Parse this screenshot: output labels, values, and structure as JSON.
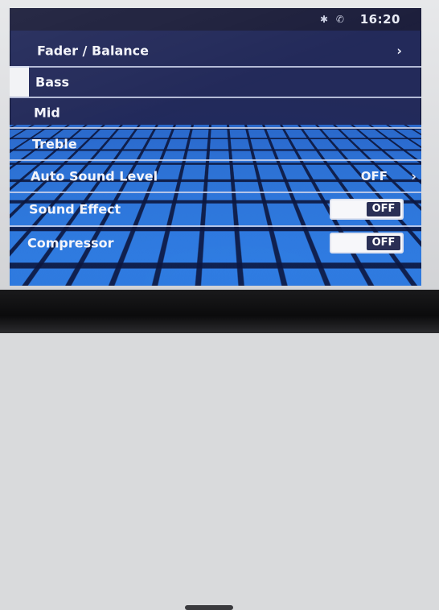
{
  "status_bar": {
    "icons": [
      "bluetooth-icon",
      "phone-muted-icon"
    ],
    "time": "16:20"
  },
  "settings": [
    {
      "label": "Fader / Balance",
      "control": "chevron"
    },
    {
      "label": "Bass",
      "control": "none"
    },
    {
      "label": "Mid",
      "control": "none"
    },
    {
      "label": "Treble",
      "control": "none"
    },
    {
      "label": "Auto Sound Level",
      "control": "value-chevron",
      "value": "OFF"
    },
    {
      "label": "Sound Effect",
      "control": "toggle",
      "value": "OFF"
    },
    {
      "label": "Compressor",
      "control": "toggle",
      "value": "OFF"
    }
  ],
  "colors": {
    "screen_bg": "#1f2a5e",
    "grid_accent": "#2f7ee6",
    "text": "#f3f4fa"
  }
}
